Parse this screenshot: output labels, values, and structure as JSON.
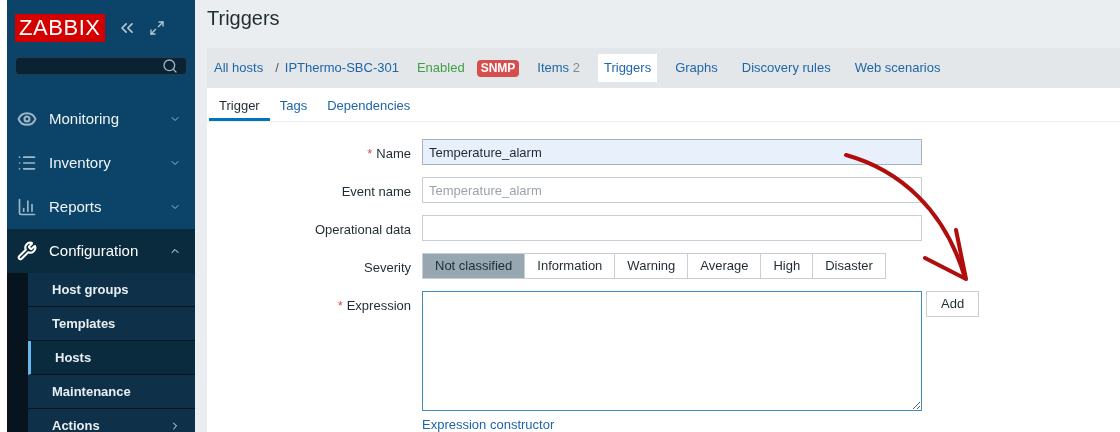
{
  "sidebar": {
    "logo": "ZABBIX",
    "menu": [
      {
        "label": "Monitoring",
        "expanded": false
      },
      {
        "label": "Inventory",
        "expanded": false
      },
      {
        "label": "Reports",
        "expanded": false
      },
      {
        "label": "Configuration",
        "expanded": true,
        "children": [
          {
            "label": "Host groups",
            "selected": false,
            "has_submenu": false
          },
          {
            "label": "Templates",
            "selected": false,
            "has_submenu": false
          },
          {
            "label": "Hosts",
            "selected": true,
            "has_submenu": false
          },
          {
            "label": "Maintenance",
            "selected": false,
            "has_submenu": false
          },
          {
            "label": "Actions",
            "selected": false,
            "has_submenu": true
          }
        ]
      }
    ]
  },
  "page": {
    "title": "Triggers"
  },
  "host_nav": {
    "breadcrumb": [
      "All hosts",
      "IPThermo-SBC-301"
    ],
    "separator": "/",
    "status": "Enabled",
    "badge": "SNMP",
    "tabs": [
      {
        "label": "Items",
        "count": "2",
        "selected": false
      },
      {
        "label": "Triggers",
        "selected": true
      },
      {
        "label": "Graphs",
        "selected": false
      },
      {
        "label": "Discovery rules",
        "selected": false
      },
      {
        "label": "Web scenarios",
        "selected": false
      }
    ]
  },
  "form_tabs": [
    {
      "label": "Trigger",
      "selected": true
    },
    {
      "label": "Tags",
      "selected": false
    },
    {
      "label": "Dependencies",
      "selected": false
    }
  ],
  "form": [
    {
      "kind": "text",
      "label": "Name",
      "required_mark": "*",
      "value": "Temperature_alarm",
      "focused": true
    },
    {
      "kind": "text",
      "label": "Event name",
      "placeholder": "Temperature_alarm",
      "focused": false
    },
    {
      "kind": "text",
      "label": "Operational data",
      "focused": false
    },
    {
      "kind": "segmented",
      "label": "Severity",
      "options": [
        {
          "label": "Not classified",
          "selected": true
        },
        {
          "label": "Information",
          "selected": false
        },
        {
          "label": "Warning",
          "selected": false
        },
        {
          "label": "Average",
          "selected": false
        },
        {
          "label": "High",
          "selected": false
        },
        {
          "label": "Disaster",
          "selected": false
        }
      ]
    },
    {
      "kind": "textarea",
      "label": "Expression",
      "required_mark": "*",
      "button": "Add",
      "link": "Expression constructor"
    }
  ]
}
